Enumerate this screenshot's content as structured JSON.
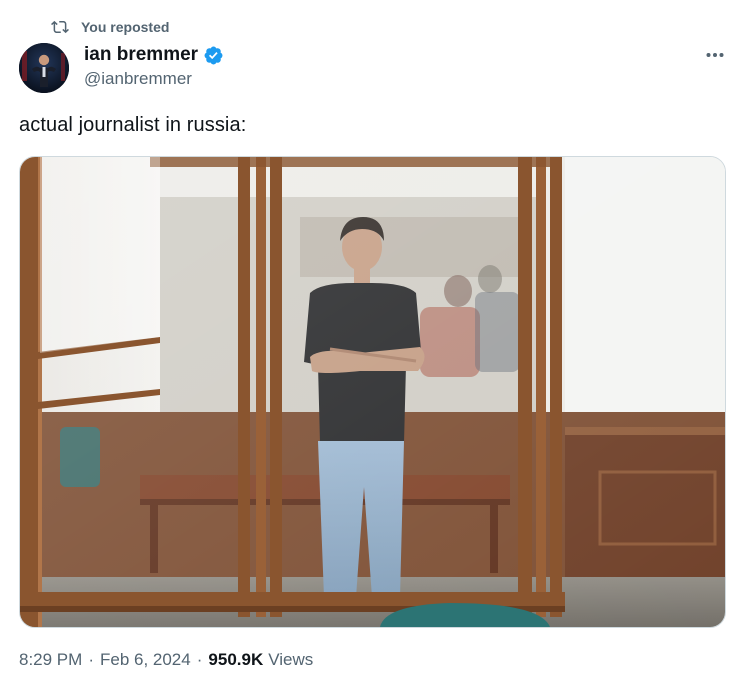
{
  "repost": {
    "label": "You reposted",
    "icon": "repost-icon"
  },
  "author": {
    "name": "ian bremmer",
    "handle": "@ianbremmer",
    "verified_icon": "verified-badge-icon",
    "verified_color": "#1d9bf0"
  },
  "more_icon": "more-dots-icon",
  "tweet": {
    "text": "actual journalist in russia:"
  },
  "media": {
    "subject": "photo-man-in-glass-courtroom-cage"
  },
  "meta": {
    "time": "8:29 PM",
    "separator": "·",
    "date": "Feb 6, 2024",
    "views_count": "950.9K",
    "views_label": "Views"
  },
  "colors": {
    "text_primary": "#0f1419",
    "text_secondary": "#536471",
    "accent": "#1d9bf0",
    "border": "#cfd9de"
  }
}
